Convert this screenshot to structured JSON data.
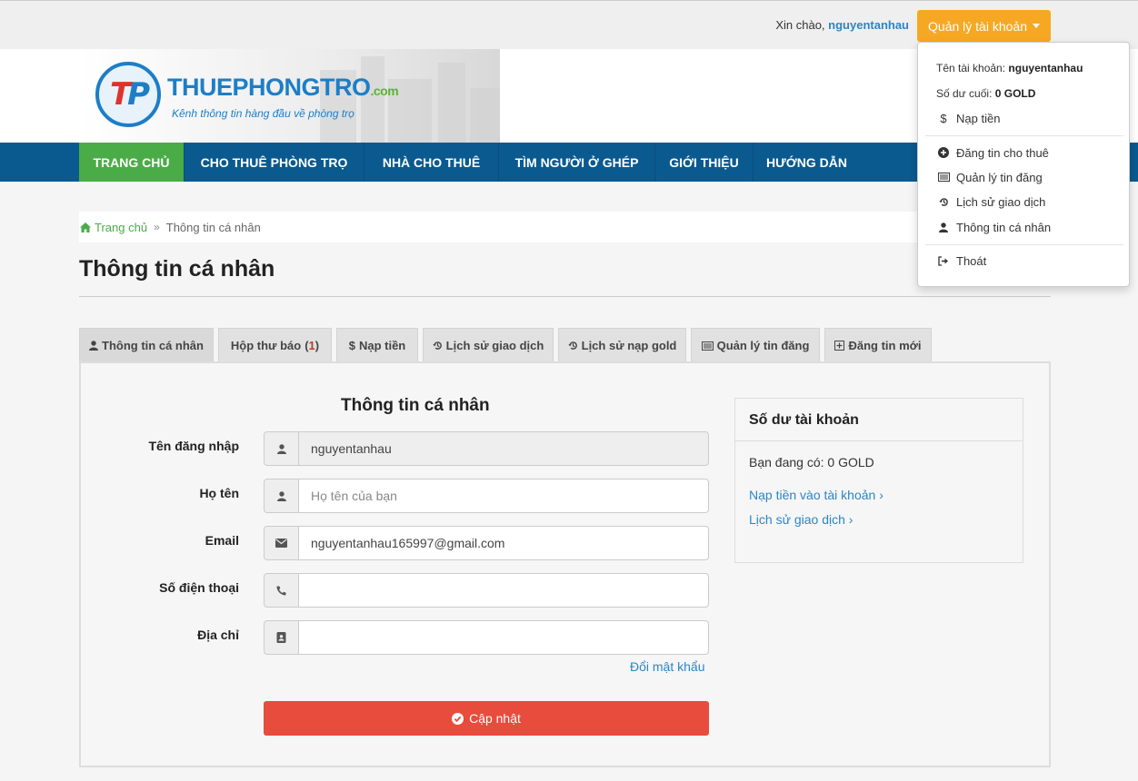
{
  "topbar": {
    "greeting": "Xin chào,",
    "username": "nguyentanhau",
    "account_button": "Quản lý tài khoản"
  },
  "brand": {
    "name": "THUEPHONGTRO",
    "suffix": ".com",
    "tagline": "Kênh thông tin hàng đầu về phòng trọ",
    "colors": {
      "blue": "#1d7ec7",
      "red": "#e0322c",
      "green": "#5cb338"
    }
  },
  "nav": {
    "items": [
      {
        "label": "TRANG CHỦ"
      },
      {
        "label": "CHO THUÊ PHÒNG TRỌ"
      },
      {
        "label": "NHÀ CHO THUÊ"
      },
      {
        "label": "TÌM NGƯỜI Ở GHÉP"
      },
      {
        "label": "GIỚI THIỆU"
      },
      {
        "label": "HƯỚNG DẪN"
      }
    ],
    "active_index": 0
  },
  "breadcrumb": {
    "home": "Trang chủ",
    "current": "Thông tin cá nhân"
  },
  "page": {
    "title": "Thông tin cá nhân"
  },
  "tabs": [
    {
      "label": "Thông tin cá nhân",
      "icon": "user-icon"
    },
    {
      "label": "Hộp thư báo",
      "count": "1"
    },
    {
      "label": "Nạp tiền",
      "icon": "dollar-icon"
    },
    {
      "label": "Lịch sử giao dịch",
      "icon": "history-icon"
    },
    {
      "label": "Lịch sử nạp gold",
      "icon": "history-icon"
    },
    {
      "label": "Quản lý tin đăng",
      "icon": "list-icon"
    },
    {
      "label": "Đăng tin mới",
      "icon": "plus-square-icon"
    }
  ],
  "form": {
    "title": "Thông tin cá nhân",
    "username": {
      "label": "Tên đăng nhập",
      "value": "nguyentanhau"
    },
    "fullname": {
      "label": "Họ tên",
      "value": "",
      "placeholder": "Họ tên của bạn"
    },
    "email": {
      "label": "Email",
      "value": "nguyentanhau165997@gmail.com"
    },
    "phone": {
      "label": "Số điện thoại",
      "value": ""
    },
    "address": {
      "label": "Địa chỉ",
      "value": ""
    },
    "change_password": "Đổi mật khẩu",
    "submit": "Cập nhật"
  },
  "balance": {
    "title": "Số dư tài khoản",
    "text": "Bạn đang có: 0 GOLD",
    "links": [
      "Nạp tiền vào tài khoản",
      "Lịch sử giao dịch"
    ]
  },
  "dropdown": {
    "account_label": "Tên tài khoản:",
    "account_value": "nguyentanhau",
    "balance_label": "Số dư cuối:",
    "balance_value": "0 GOLD",
    "items": [
      {
        "label": "Nạp tiền",
        "icon": "dollar-icon"
      },
      {
        "label": "Đăng tin cho thuê",
        "icon": "plus-circle-icon"
      },
      {
        "label": "Quản lý tin đăng",
        "icon": "list-icon"
      },
      {
        "label": "Lịch sử giao dịch",
        "icon": "history-icon"
      },
      {
        "label": "Thông tin cá nhân",
        "icon": "user-icon"
      },
      {
        "label": "Thoát",
        "icon": "sign-out-icon"
      }
    ]
  },
  "colors": {
    "accent_orange": "#f7a823",
    "nav_blue": "#0a5a90",
    "nav_active_green": "#4aac47",
    "submit_red": "#e74c3c",
    "link_blue": "#2a86c8"
  }
}
